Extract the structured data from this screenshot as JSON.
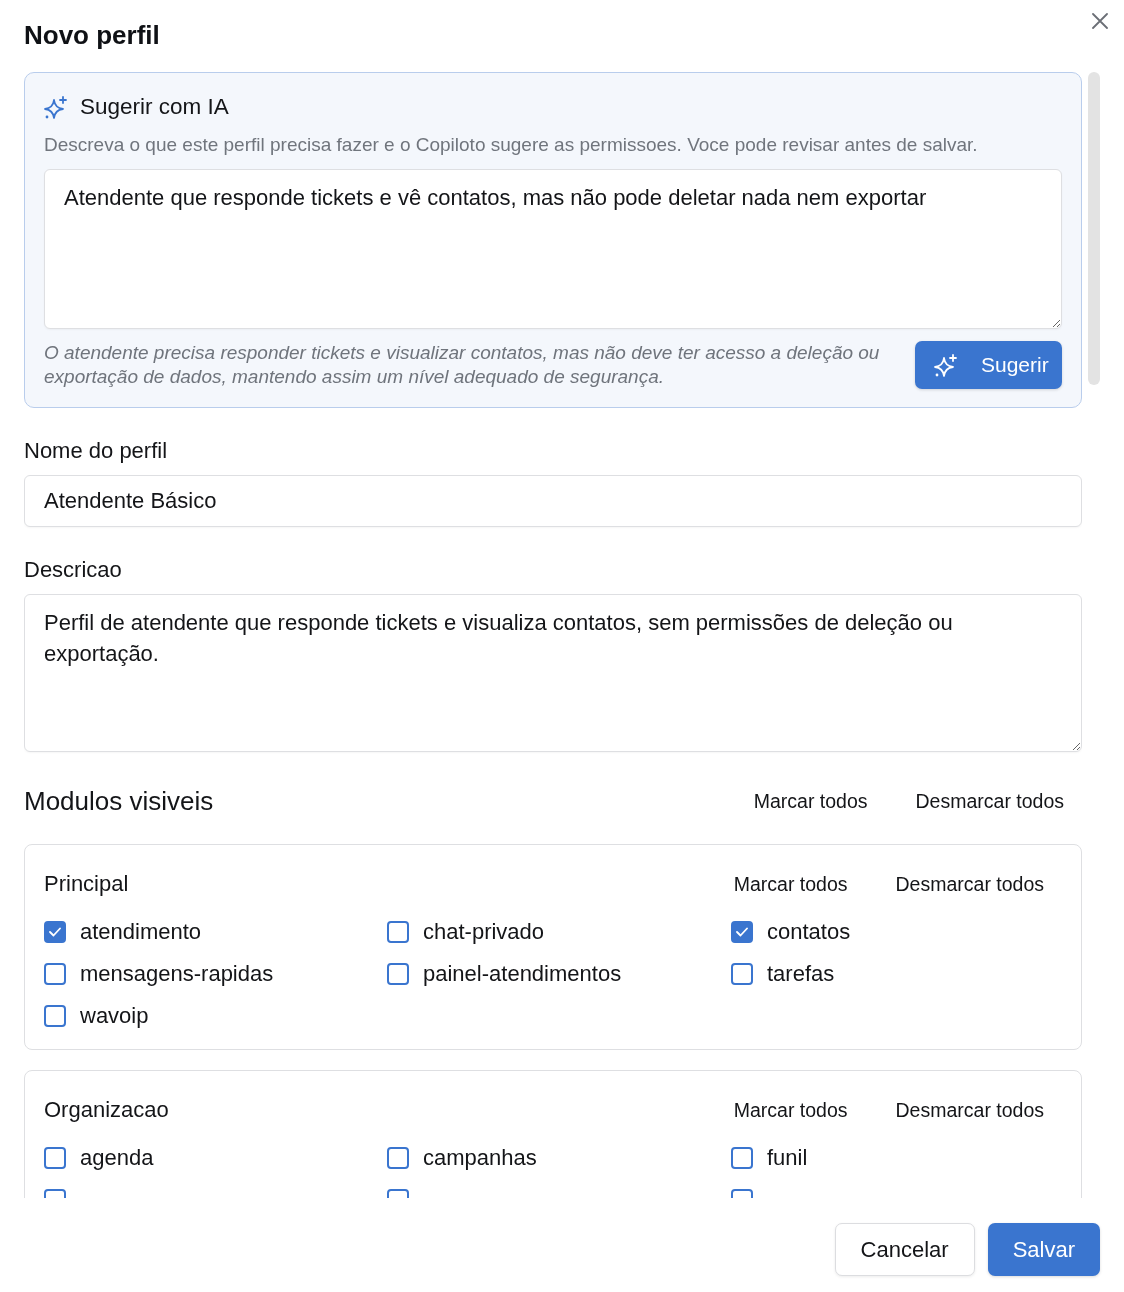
{
  "dialog": {
    "title": "Novo perfil"
  },
  "ai_suggest": {
    "title": "Sugerir com IA",
    "hint": "Descreva o que este perfil precisa fazer e o Copiloto sugere as permissoes. Voce pode revisar antes de salvar.",
    "prompt": "Atendente que responde tickets e vê contatos, mas não pode deletar nada nem exportar",
    "summary": "O atendente precisa responder tickets e visualizar contatos, mas não deve ter acesso a deleção ou exportação de dados, mantendo assim um nível adequado de segurança.",
    "button": "Sugerir"
  },
  "profile_name": {
    "label": "Nome do perfil",
    "value": "Atendente Básico"
  },
  "description": {
    "label": "Descricao",
    "value": "Perfil de atendente que responde tickets e visualiza contatos, sem permissões de deleção ou exportação."
  },
  "modules": {
    "title": "Modulos visiveis",
    "actions": [
      "Marcar todos",
      "Desmarcar todos"
    ],
    "groups": [
      {
        "title": "Principal",
        "actions": [
          "Marcar todos",
          "Desmarcar todos"
        ],
        "items": [
          {
            "label": "atendimento",
            "checked": true
          },
          {
            "label": "chat-privado",
            "checked": false
          },
          {
            "label": "contatos",
            "checked": true
          },
          {
            "label": "mensagens-rapidas",
            "checked": false
          },
          {
            "label": "painel-atendimentos",
            "checked": false
          },
          {
            "label": "tarefas",
            "checked": false
          },
          {
            "label": "wavoip",
            "checked": false
          }
        ]
      },
      {
        "title": "Organizacao",
        "actions": [
          "Marcar todos",
          "Desmarcar todos"
        ],
        "items": [
          {
            "label": "agenda",
            "checked": false
          },
          {
            "label": "campanhas",
            "checked": false
          },
          {
            "label": "funil",
            "checked": false
          },
          {
            "checked": false
          },
          {
            "checked": false
          },
          {
            "checked": false
          }
        ]
      }
    ]
  },
  "footer": {
    "buttons": [
      {
        "label": "Cancelar",
        "kind": "cancel"
      },
      {
        "label": "Salvar",
        "kind": "save"
      }
    ]
  }
}
